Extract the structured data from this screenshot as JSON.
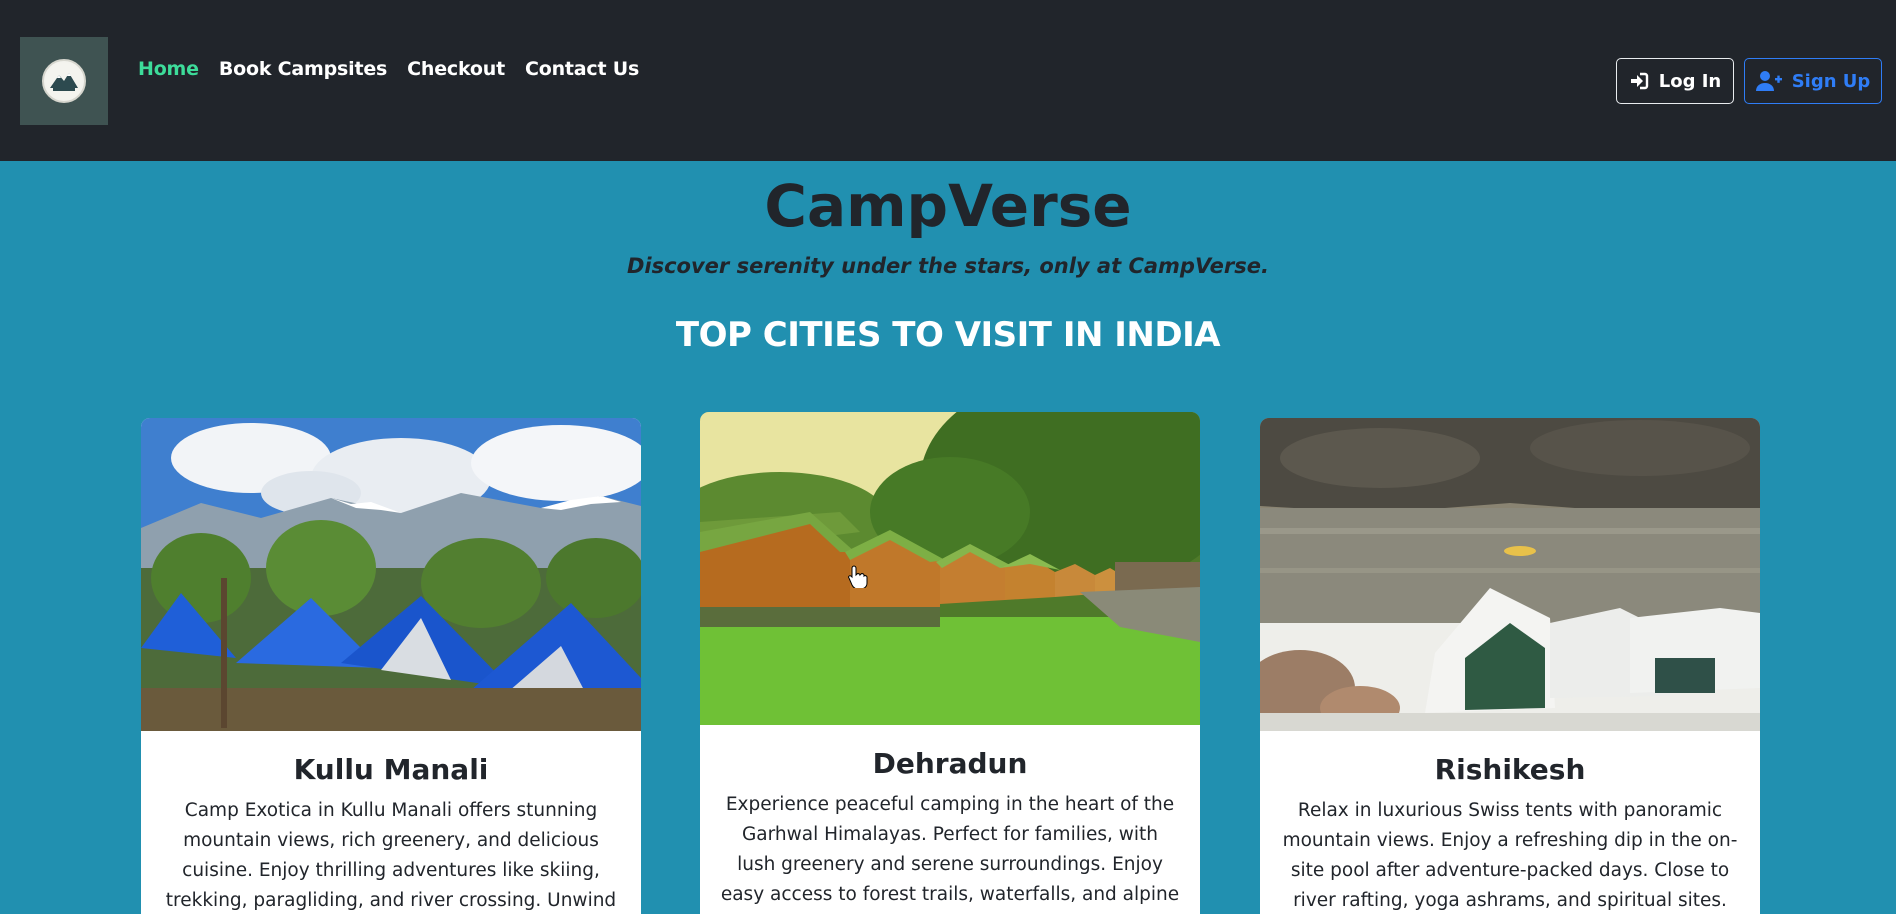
{
  "navbar": {
    "links": [
      {
        "label": "Home",
        "active": true
      },
      {
        "label": "Book Campsites",
        "active": false
      },
      {
        "label": "Checkout",
        "active": false
      },
      {
        "label": "Contact Us",
        "active": false
      }
    ],
    "login_label": "Log In",
    "signup_label": "Sign Up",
    "logo_icon": "campverse-logo"
  },
  "hero": {
    "title": "CampVerse",
    "tagline": "Discover serenity under the stars, only at CampVerse.",
    "section_heading": "TOP CITIES TO VISIT IN INDIA"
  },
  "cards": [
    {
      "title": "Kullu Manali",
      "text": "Camp Exotica in Kullu Manali offers stunning mountain views, rich greenery, and delicious cuisine. Enjoy thrilling adventures like skiing, trekking, paragliding, and river crossing. Unwind by",
      "image": "blue-tents-mountains"
    },
    {
      "title": "Dehradun",
      "text": "Experience peaceful camping in the heart of the Garhwal Himalayas. Perfect for families, with lush greenery and serene surroundings. Enjoy easy access to forest trails, waterfalls, and alpine treks.",
      "image": "cottage-tents-meadow"
    },
    {
      "title": "Rishikesh",
      "text": "Relax in luxurious Swiss tents with panoramic mountain views. Enjoy a refreshing dip in the on-site pool after adventure-packed days. Close to river rafting, yoga ashrams, and spiritual sites. Ideal for",
      "image": "river-rafting-tents"
    }
  ],
  "colors": {
    "navbar_bg": "#21252b",
    "page_bg": "#2190b0",
    "active_link": "#3ddc9a",
    "signup_blue": "#2f7df6"
  }
}
